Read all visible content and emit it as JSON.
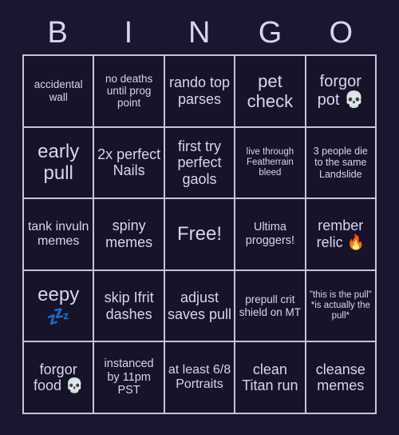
{
  "card": {
    "title": "BINGO",
    "header_letters": [
      "B",
      "I",
      "N",
      "G",
      "O"
    ],
    "colors": {
      "page_background": "#1a1630",
      "cell_background": "#171328",
      "grid_line": "#c8c3e0",
      "text": "#d9d5f0"
    },
    "rows": [
      [
        {
          "text": "accidental wall",
          "size": "fs-13"
        },
        {
          "text": "no deaths until prog point",
          "size": "fs-13"
        },
        {
          "text": "rando top parses",
          "size": "fs-18"
        },
        {
          "text": "pet check",
          "size": "fs-22"
        },
        {
          "text": "forgor pot 💀",
          "size": "fs-20"
        }
      ],
      [
        {
          "text": "early pull",
          "size": "fs-24"
        },
        {
          "text": "2x perfect Nails",
          "size": "fs-18"
        },
        {
          "text": "first try perfect gaols",
          "size": "fs-18"
        },
        {
          "text": "live through Featherrain bleed",
          "size": "fs-11"
        },
        {
          "text": "3 people die to the same Landslide",
          "size": "fs-12"
        }
      ],
      [
        {
          "text": "tank invuln memes",
          "size": "fs-16"
        },
        {
          "text": "spiny memes",
          "size": "fs-18"
        },
        {
          "text": "Free!",
          "size": "fs-24"
        },
        {
          "text": "Ultima proggers!",
          "size": "fs-14"
        },
        {
          "text": "rember relic 🔥",
          "size": "fs-18"
        }
      ],
      [
        {
          "text": "eepy 💤",
          "size": "fs-24"
        },
        {
          "text": "skip Ifrit dashes",
          "size": "fs-18"
        },
        {
          "text": "adjust saves pull",
          "size": "fs-18"
        },
        {
          "text": "prepull crit shield on MT",
          "size": "fs-13"
        },
        {
          "text": "\"this is the pull\" *is actually the pull*",
          "size": "fs-11"
        }
      ],
      [
        {
          "text": "forgor food 💀",
          "size": "fs-18"
        },
        {
          "text": "instanced by 11pm PST",
          "size": "fs-14"
        },
        {
          "text": "at least 6/8 Portraits",
          "size": "fs-16"
        },
        {
          "text": "clean Titan run",
          "size": "fs-18"
        },
        {
          "text": "cleanse memes",
          "size": "fs-18"
        }
      ]
    ]
  }
}
